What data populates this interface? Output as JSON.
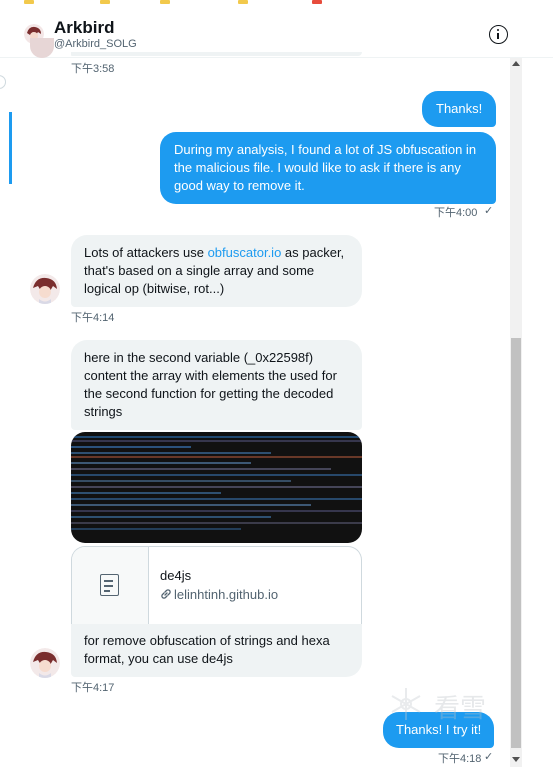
{
  "header": {
    "name": "Arkbird",
    "handle": "@Arkbird_SOLG"
  },
  "icons": {
    "info": "info-icon",
    "document": "document-icon",
    "link": "link-icon",
    "check": "check-icon"
  },
  "colors": {
    "accent": "#1d9bf0",
    "incoming_bubble": "#eff3f4",
    "muted_text": "#536471"
  },
  "messages": [
    {
      "time": "下午3:58"
    },
    {
      "text": "Thanks!"
    },
    {
      "text": "During my analysis, I found a lot of JS obfuscation in the malicious file. I would like to ask if there is any good way to remove it.",
      "time": "下午4:00",
      "status": "✓"
    },
    {
      "text_before": "Lots of attackers use ",
      "link": "obfuscator.io",
      "text_after": " as packer, that's based on a single array and some logical op (bitwise, rot...)",
      "time": "下午4:14"
    },
    {
      "text": "here in the second variable (_0x22598f) content the array with elements the used for the second function for getting the decoded strings"
    },
    {
      "card_title": "de4js",
      "card_url": "lelinhtinh.github.io"
    },
    {
      "text": "for remove obfuscation of strings and hexa format, you can use de4js",
      "time": "下午4:17"
    },
    {
      "text": "Thanks! I try it!",
      "time": "下午4:18",
      "status": "✓"
    }
  ],
  "watermark": {
    "text": "看雪"
  }
}
